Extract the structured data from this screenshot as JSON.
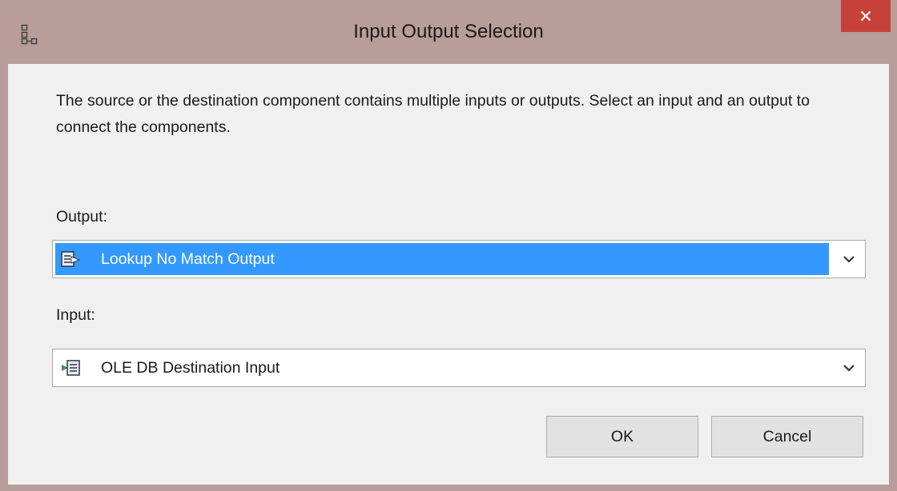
{
  "window": {
    "title": "Input Output Selection",
    "icon": "component-diagram-icon",
    "close_icon": "close-icon"
  },
  "dialog": {
    "message": "The source or the destination component contains multiple inputs or outputs. Select an input and an output to connect the components.",
    "output": {
      "label": "Output:",
      "selected_value": "Lookup No Match Output",
      "icon": "output-path-icon"
    },
    "input": {
      "label": "Input:",
      "selected_value": "OLE DB Destination Input",
      "icon": "input-path-icon"
    },
    "ok_label": "OK",
    "cancel_label": "Cancel"
  },
  "colors": {
    "title_bar": "#b89d9b",
    "close_button": "#c7413a",
    "selection": "#3399ff",
    "client_background": "#f0f0f0"
  }
}
